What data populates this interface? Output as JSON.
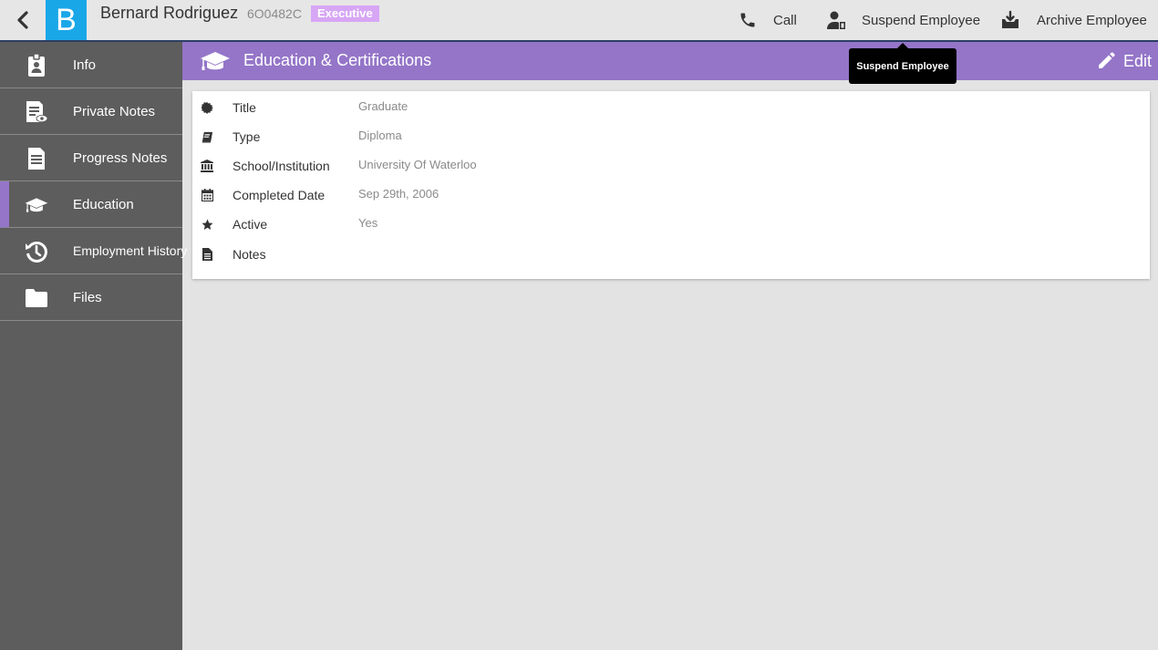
{
  "header": {
    "logo_letter": "B",
    "employee_name": "Bernard Rodriguez",
    "employee_id": "6O0482C",
    "role_badge": "Executive"
  },
  "actions": {
    "call": "Call",
    "suspend": "Suspend Employee",
    "archive": "Archive Employee"
  },
  "tooltip": "Suspend Employee",
  "sidebar": {
    "items": [
      {
        "label": "Info",
        "icon": "id-badge-icon"
      },
      {
        "label": "Private Notes",
        "icon": "private-notes-icon"
      },
      {
        "label": "Progress Notes",
        "icon": "document-icon"
      },
      {
        "label": "Education",
        "icon": "graduation-cap-icon",
        "active": true
      },
      {
        "label": "Employment History",
        "icon": "history-icon"
      },
      {
        "label": "Files",
        "icon": "folder-icon"
      }
    ]
  },
  "section": {
    "title": "Education & Certifications",
    "edit_label": "Edit"
  },
  "details": [
    {
      "label": "Title",
      "value": "Graduate",
      "icon": "certificate-icon"
    },
    {
      "label": "Type",
      "value": "Diploma",
      "icon": "book-icon"
    },
    {
      "label": "School/Institution",
      "value": "University Of Waterloo",
      "icon": "institution-icon"
    },
    {
      "label": "Completed Date",
      "value": "Sep 29th, 2006",
      "icon": "calendar-icon"
    },
    {
      "label": "Active",
      "value": "Yes",
      "icon": "star-icon"
    },
    {
      "label": "Notes",
      "value": "",
      "icon": "file-text-icon"
    }
  ],
  "colors": {
    "accent": "#9475c8",
    "logo": "#1aa7e8",
    "badge": "#d7a6f5",
    "sidebar": "#5d5d5d"
  }
}
